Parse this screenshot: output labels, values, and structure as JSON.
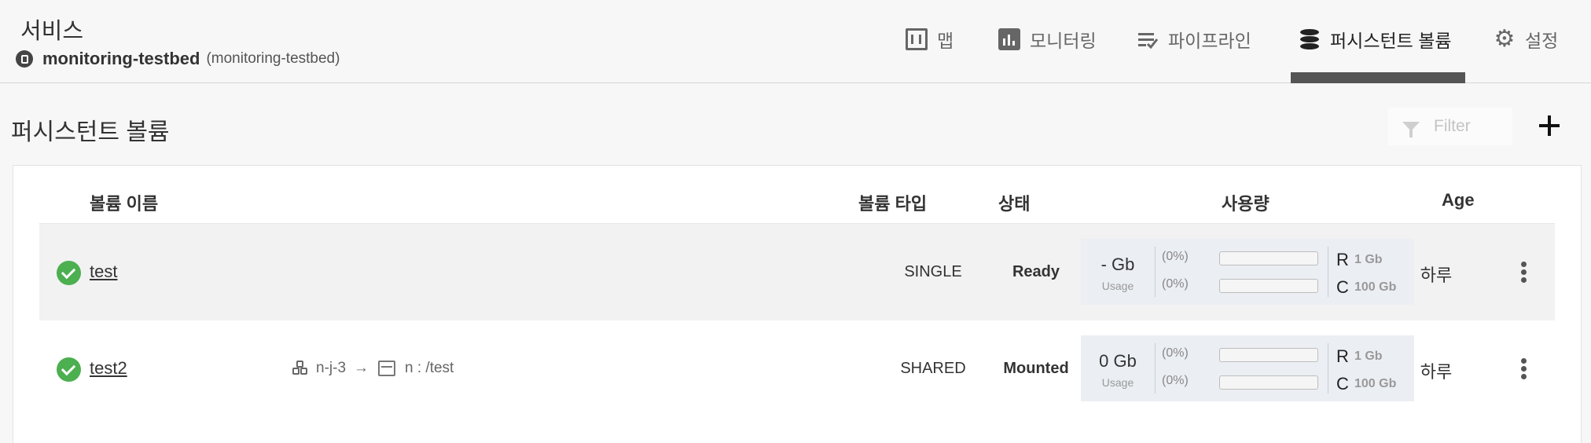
{
  "header": {
    "title": "서비스",
    "service_name": "monitoring-testbed",
    "service_namespace": "(monitoring-testbed)"
  },
  "nav": {
    "items": [
      {
        "label": "맵",
        "icon": "map-icon"
      },
      {
        "label": "모니터링",
        "icon": "bar-chart-icon"
      },
      {
        "label": "파이프라인",
        "icon": "pipeline-icon"
      },
      {
        "label": "퍼시스턴트 볼륨",
        "icon": "database-icon",
        "active": true
      },
      {
        "label": "설정",
        "icon": "gear-icon"
      }
    ]
  },
  "page": {
    "title": "퍼시스턴트 볼륨",
    "filter_placeholder": "Filter"
  },
  "table": {
    "columns": {
      "name": "볼륨 이름",
      "type": "볼륨 타입",
      "status": "상태",
      "usage": "사용량",
      "age": "Age"
    },
    "rows": [
      {
        "name": "test",
        "status_icon": "check-circle-icon",
        "type": "SINGLE",
        "status": "Ready",
        "usage_value": "- Gb",
        "usage_label": "Usage",
        "pct_r": "(0%)",
        "pct_c": "(0%)",
        "bar_r_fraction": 0,
        "bar_c_fraction": 0,
        "r_letter": "R",
        "r_value": "1 Gb",
        "c_letter": "C",
        "c_value": "100 Gb",
        "age": "하루"
      },
      {
        "name": "test2",
        "status_icon": "check-circle-icon",
        "node": "n-j-3",
        "arrow": "→",
        "mount_path": "n : /test",
        "type": "SHARED",
        "status": "Mounted",
        "usage_value": "0 Gb",
        "usage_label": "Usage",
        "pct_r": "(0%)",
        "pct_c": "(0%)",
        "bar_r_fraction": 0,
        "bar_c_fraction": 0,
        "r_letter": "R",
        "r_value": "1 Gb",
        "c_letter": "C",
        "c_value": "100 Gb",
        "age": "하루"
      }
    ]
  }
}
